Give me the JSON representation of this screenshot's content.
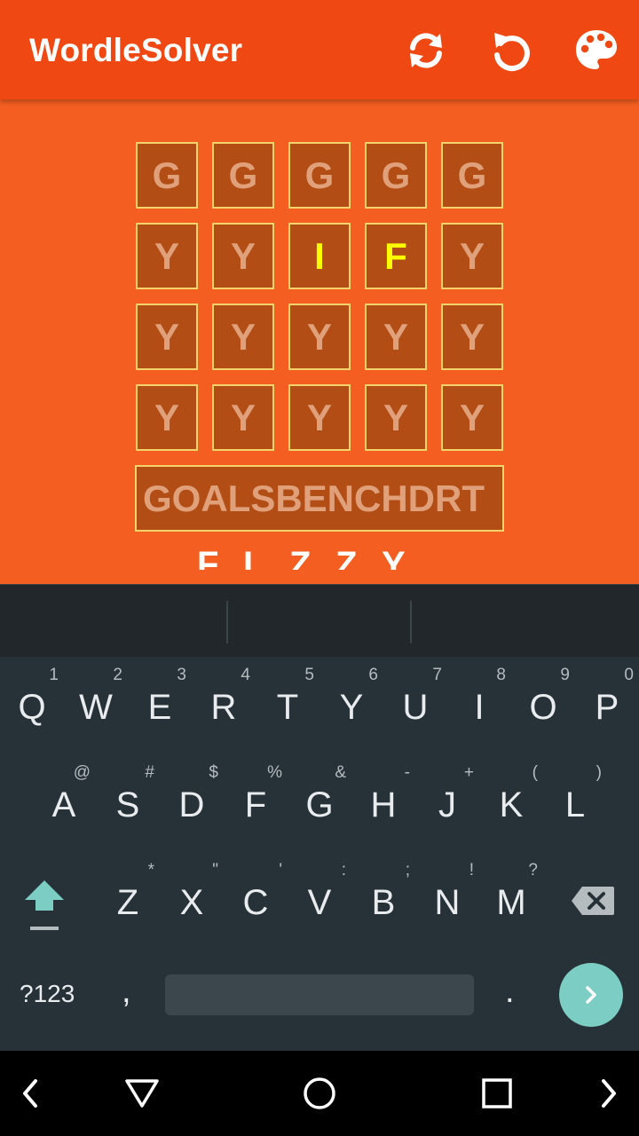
{
  "app": {
    "title": "WordleSolver",
    "icons": [
      "refresh-icon",
      "undo-icon",
      "palette-icon"
    ],
    "accent_color": "#f04812",
    "background_color": "#f45e20"
  },
  "grid": {
    "rows": [
      [
        "G",
        "G",
        "G",
        "G",
        "G"
      ],
      [
        "Y",
        "Y",
        "I",
        "F",
        "Y"
      ],
      [
        "Y",
        "Y",
        "Y",
        "Y",
        "Y"
      ],
      [
        "Y",
        "Y",
        "Y",
        "Y",
        "Y"
      ]
    ],
    "highlight_color": "#ffff00"
  },
  "letters_field": {
    "value": "GOALSBENCHDRT"
  },
  "answer_row": [
    "F",
    "I",
    "Z",
    "Z",
    "Y"
  ],
  "keyboard": {
    "row1": [
      {
        "key": "Q",
        "hint": "1"
      },
      {
        "key": "W",
        "hint": "2"
      },
      {
        "key": "E",
        "hint": "3"
      },
      {
        "key": "R",
        "hint": "4"
      },
      {
        "key": "T",
        "hint": "5"
      },
      {
        "key": "Y",
        "hint": "6"
      },
      {
        "key": "U",
        "hint": "7"
      },
      {
        "key": "I",
        "hint": "8"
      },
      {
        "key": "O",
        "hint": "9"
      },
      {
        "key": "P",
        "hint": "0"
      }
    ],
    "row2": [
      {
        "key": "A",
        "hint": "@"
      },
      {
        "key": "S",
        "hint": "#"
      },
      {
        "key": "D",
        "hint": "$"
      },
      {
        "key": "F",
        "hint": "%"
      },
      {
        "key": "G",
        "hint": "&"
      },
      {
        "key": "H",
        "hint": "-"
      },
      {
        "key": "J",
        "hint": "+"
      },
      {
        "key": "K",
        "hint": "("
      },
      {
        "key": "L",
        "hint": ")"
      }
    ],
    "row3": [
      {
        "key": "Z",
        "hint": "*"
      },
      {
        "key": "X",
        "hint": "\""
      },
      {
        "key": "C",
        "hint": "'"
      },
      {
        "key": "V",
        "hint": ":"
      },
      {
        "key": "B",
        "hint": ";"
      },
      {
        "key": "N",
        "hint": "!"
      },
      {
        "key": "M",
        "hint": "?"
      }
    ],
    "symbols_label": "?123",
    "comma": ",",
    "period": ".",
    "shift_icon": "shift-icon",
    "backspace_icon": "backspace-icon",
    "enter_icon": "next-arrow-icon"
  },
  "navbar": {
    "icons": [
      "nav-left-icon",
      "back-triangle-icon",
      "home-circle-icon",
      "recents-square-icon",
      "nav-right-icon"
    ]
  }
}
